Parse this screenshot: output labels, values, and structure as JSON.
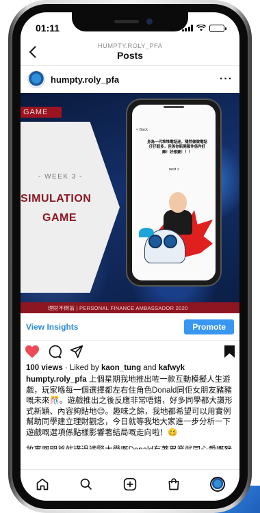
{
  "status_bar": {
    "time": "01:11"
  },
  "header": {
    "username": "HUMPTY.ROLY_PFA",
    "title": "Posts"
  },
  "post": {
    "username": "humpty.roly_pfa",
    "image": {
      "tag": "GAME",
      "week": "- WEEK 3 -",
      "title_line1": "SIMULATION",
      "title_line2": "GAME",
      "band_text": "理財不倒翁 | PERSONAL FINANCE AMBASSADOR 2020",
      "inner_back": "< Back",
      "inner_text": "身為一代堆堆電話迷，隨然做做電話仔仔較多，但係你新開都件係件好難！好想要！！！",
      "inner_next": "next >"
    }
  },
  "insights": {
    "view_label": "View Insights",
    "promote_label": "Promote"
  },
  "engagement": {
    "views": "100 views",
    "liked_prefix": " · Liked by ",
    "liker1": "kaon_tung",
    "and": " and ",
    "liker2": "kafwyk"
  },
  "caption": {
    "username": "humpty.roly_pfa",
    "text": " 上個星期我地推出咗一款互動模擬人生遊戲，玩家喺每一個選擇都左右住角色Donald同佢女朋友豬豬嘅未來🎊。遊戲推出之後反應非常唔錯，好多同學都大讚形式新穎、內容夠貼地😉。趣味之餘，我地都希望可以用實例幫助同學建立理財觀念，今日就等我地大家進一步分析一下遊戲嘅選項係點樣影響著結局嘅走向啦！🥴",
    "next_line": "故事嘅開首就講過讀緊大學嘅Donald有著畢業就同心愛嘅豬"
  },
  "colors": {
    "accent": "#3897f0",
    "link": "#2f8bd8",
    "brand_red": "#8e1622"
  },
  "icons": [
    "back-chevron-icon",
    "more-icon",
    "heart-icon",
    "comment-icon",
    "share-icon",
    "bookmark-icon",
    "home-icon",
    "search-icon",
    "add-icon",
    "shop-icon"
  ]
}
